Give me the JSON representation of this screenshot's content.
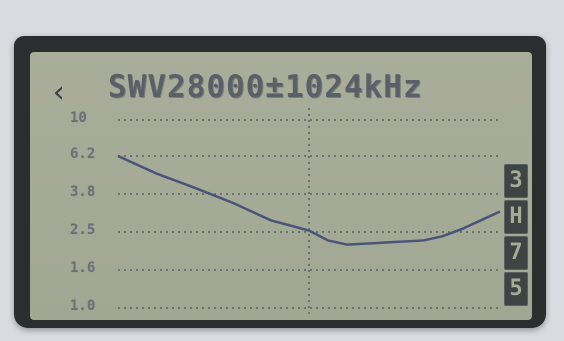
{
  "screen": {
    "title": "SWV28000±1024kHz",
    "back_icon": "chevron-left-icon"
  },
  "chart_data": {
    "type": "line",
    "title": "SWV28000±1024kHz",
    "center_khz": 28000,
    "span_khz": 1024,
    "y_tick_labels": [
      "10",
      "6.2",
      "3.8",
      "2.5",
      "1.6",
      "1.0"
    ],
    "series": [
      {
        "values": [
          [
            0.0,
            6.2
          ],
          [
            0.1,
            5.1
          ],
          [
            0.2,
            4.2
          ],
          [
            0.3,
            3.5
          ],
          [
            0.4,
            2.9
          ],
          [
            0.5,
            2.55
          ],
          [
            0.55,
            2.3
          ],
          [
            0.6,
            2.2
          ],
          [
            0.7,
            2.25
          ],
          [
            0.8,
            2.3
          ],
          [
            0.85,
            2.4
          ],
          [
            0.9,
            2.6
          ],
          [
            0.95,
            2.9
          ],
          [
            1.0,
            3.2
          ]
        ]
      }
    ],
    "grid": true,
    "line_color": "#4a5478"
  },
  "band_buttons": [
    "3",
    "H",
    "7",
    "5"
  ]
}
